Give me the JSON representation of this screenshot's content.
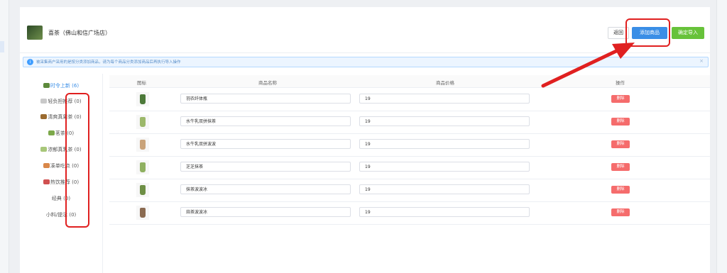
{
  "store": {
    "name": "喜茶（佛山和信广场店）"
  },
  "actions": {
    "back": "返回",
    "add": "添加商品",
    "import": "确定导入"
  },
  "notice": {
    "text": "被采集商户采用的是按分类添加商品，请为每个商品分类添加商品后再执行导入操作",
    "close": "×"
  },
  "categories": [
    {
      "label": "时令上新 (6)",
      "active": true,
      "color": "#5d8a3c"
    },
    {
      "label": "轻负担推荐 (0)",
      "active": false,
      "color": "#c9c9c9"
    },
    {
      "label": "清爽真果茶 (0)",
      "active": false,
      "color": "#9a6a2f"
    },
    {
      "label": "茗茶 (0)",
      "active": false,
      "color": "#7ca84a"
    },
    {
      "label": "浓郁真乳茶 (0)",
      "active": false,
      "color": "#a8c77a"
    },
    {
      "label": "凑单吃点 (0)",
      "active": false,
      "color": "#d9884a"
    },
    {
      "label": "热饮推荐 (0)",
      "active": false,
      "color": "#d05050"
    },
    {
      "label": "经典 (0)",
      "active": false,
      "color": ""
    },
    {
      "label": "小料/提示 (0)",
      "active": false,
      "color": ""
    }
  ],
  "table": {
    "headers": {
      "icon": "图标",
      "name": "商品名称",
      "price": "商品价格",
      "ops": "操作"
    },
    "delete_label": "删除",
    "rows": [
      {
        "name": "羽衣纤体瓶",
        "price": "19",
        "color": "#4d7a3a"
      },
      {
        "name": "水牛乳双拼抹茶",
        "price": "19",
        "color": "#9cb86a"
      },
      {
        "name": "水牛乳双拼波波",
        "price": "19",
        "color": "#c9a37a"
      },
      {
        "name": "芝芝抹茶",
        "price": "19",
        "color": "#8fb060"
      },
      {
        "name": "抹茶波波冰",
        "price": "19",
        "color": "#6e8f45"
      },
      {
        "name": "焙茶波波冰",
        "price": "19",
        "color": "#8a6a50"
      }
    ]
  },
  "annotation_color": "#e02020"
}
